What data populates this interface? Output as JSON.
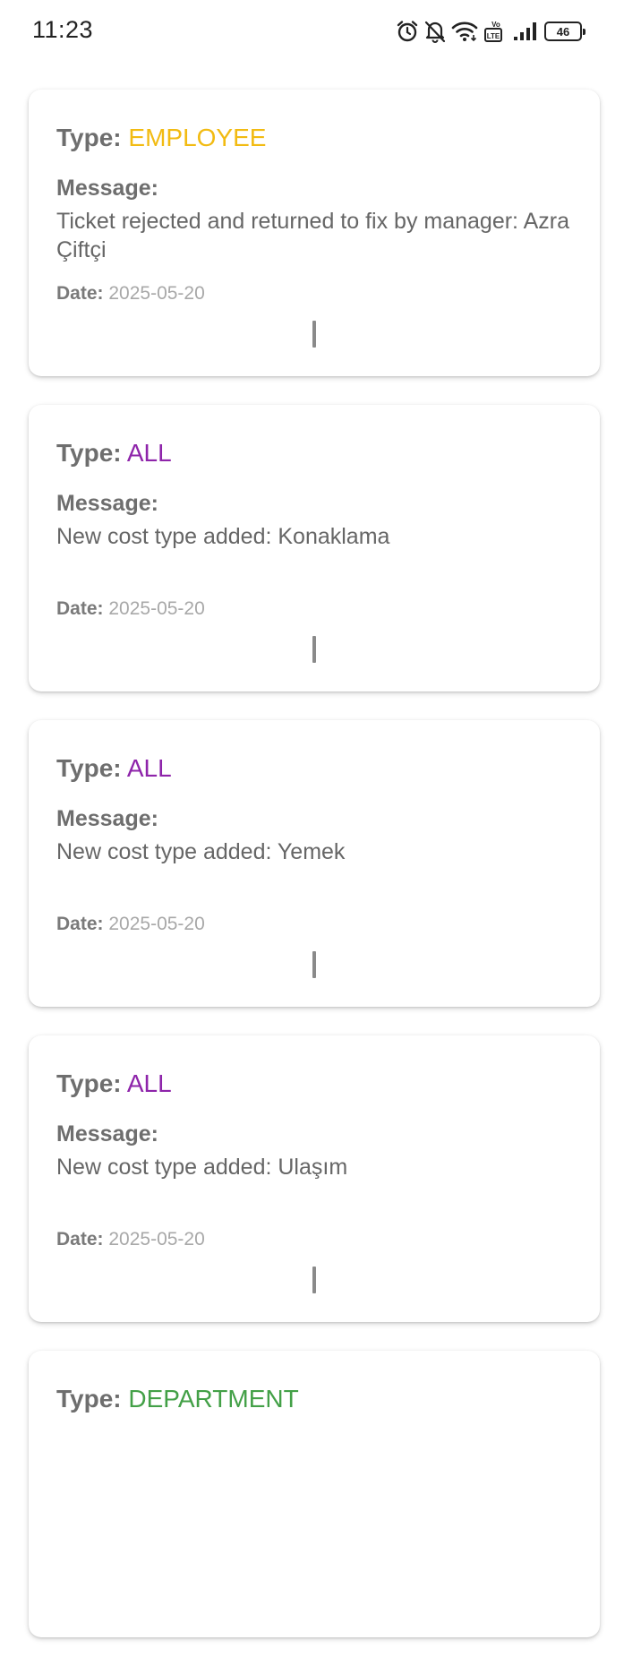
{
  "status_bar": {
    "time": "11:23",
    "battery": "46",
    "volte_label": "Vo LTE",
    "icons": [
      "alarm-icon",
      "notifications-off-icon",
      "wifi-icon",
      "volte-icon",
      "signal-icon",
      "battery-icon"
    ]
  },
  "labels": {
    "type": "Type:",
    "message": "Message:",
    "date": "Date:"
  },
  "colors": {
    "employee": "#f2bb12",
    "all": "#8e24aa",
    "department": "#43a047",
    "label": "#6e6e6e"
  },
  "notifications": [
    {
      "type": "EMPLOYEE",
      "message": "Ticket rejected and returned to fix by manager: Azra  Çiftçi",
      "date": "2025-05-20"
    },
    {
      "type": "ALL",
      "message": "New cost type added: Konaklama",
      "date": "2025-05-20"
    },
    {
      "type": "ALL",
      "message": "New cost type added: Yemek",
      "date": "2025-05-20"
    },
    {
      "type": "ALL",
      "message": "New cost type added: Ulaşım",
      "date": "2025-05-20"
    },
    {
      "type": "DEPARTMENT"
    }
  ]
}
